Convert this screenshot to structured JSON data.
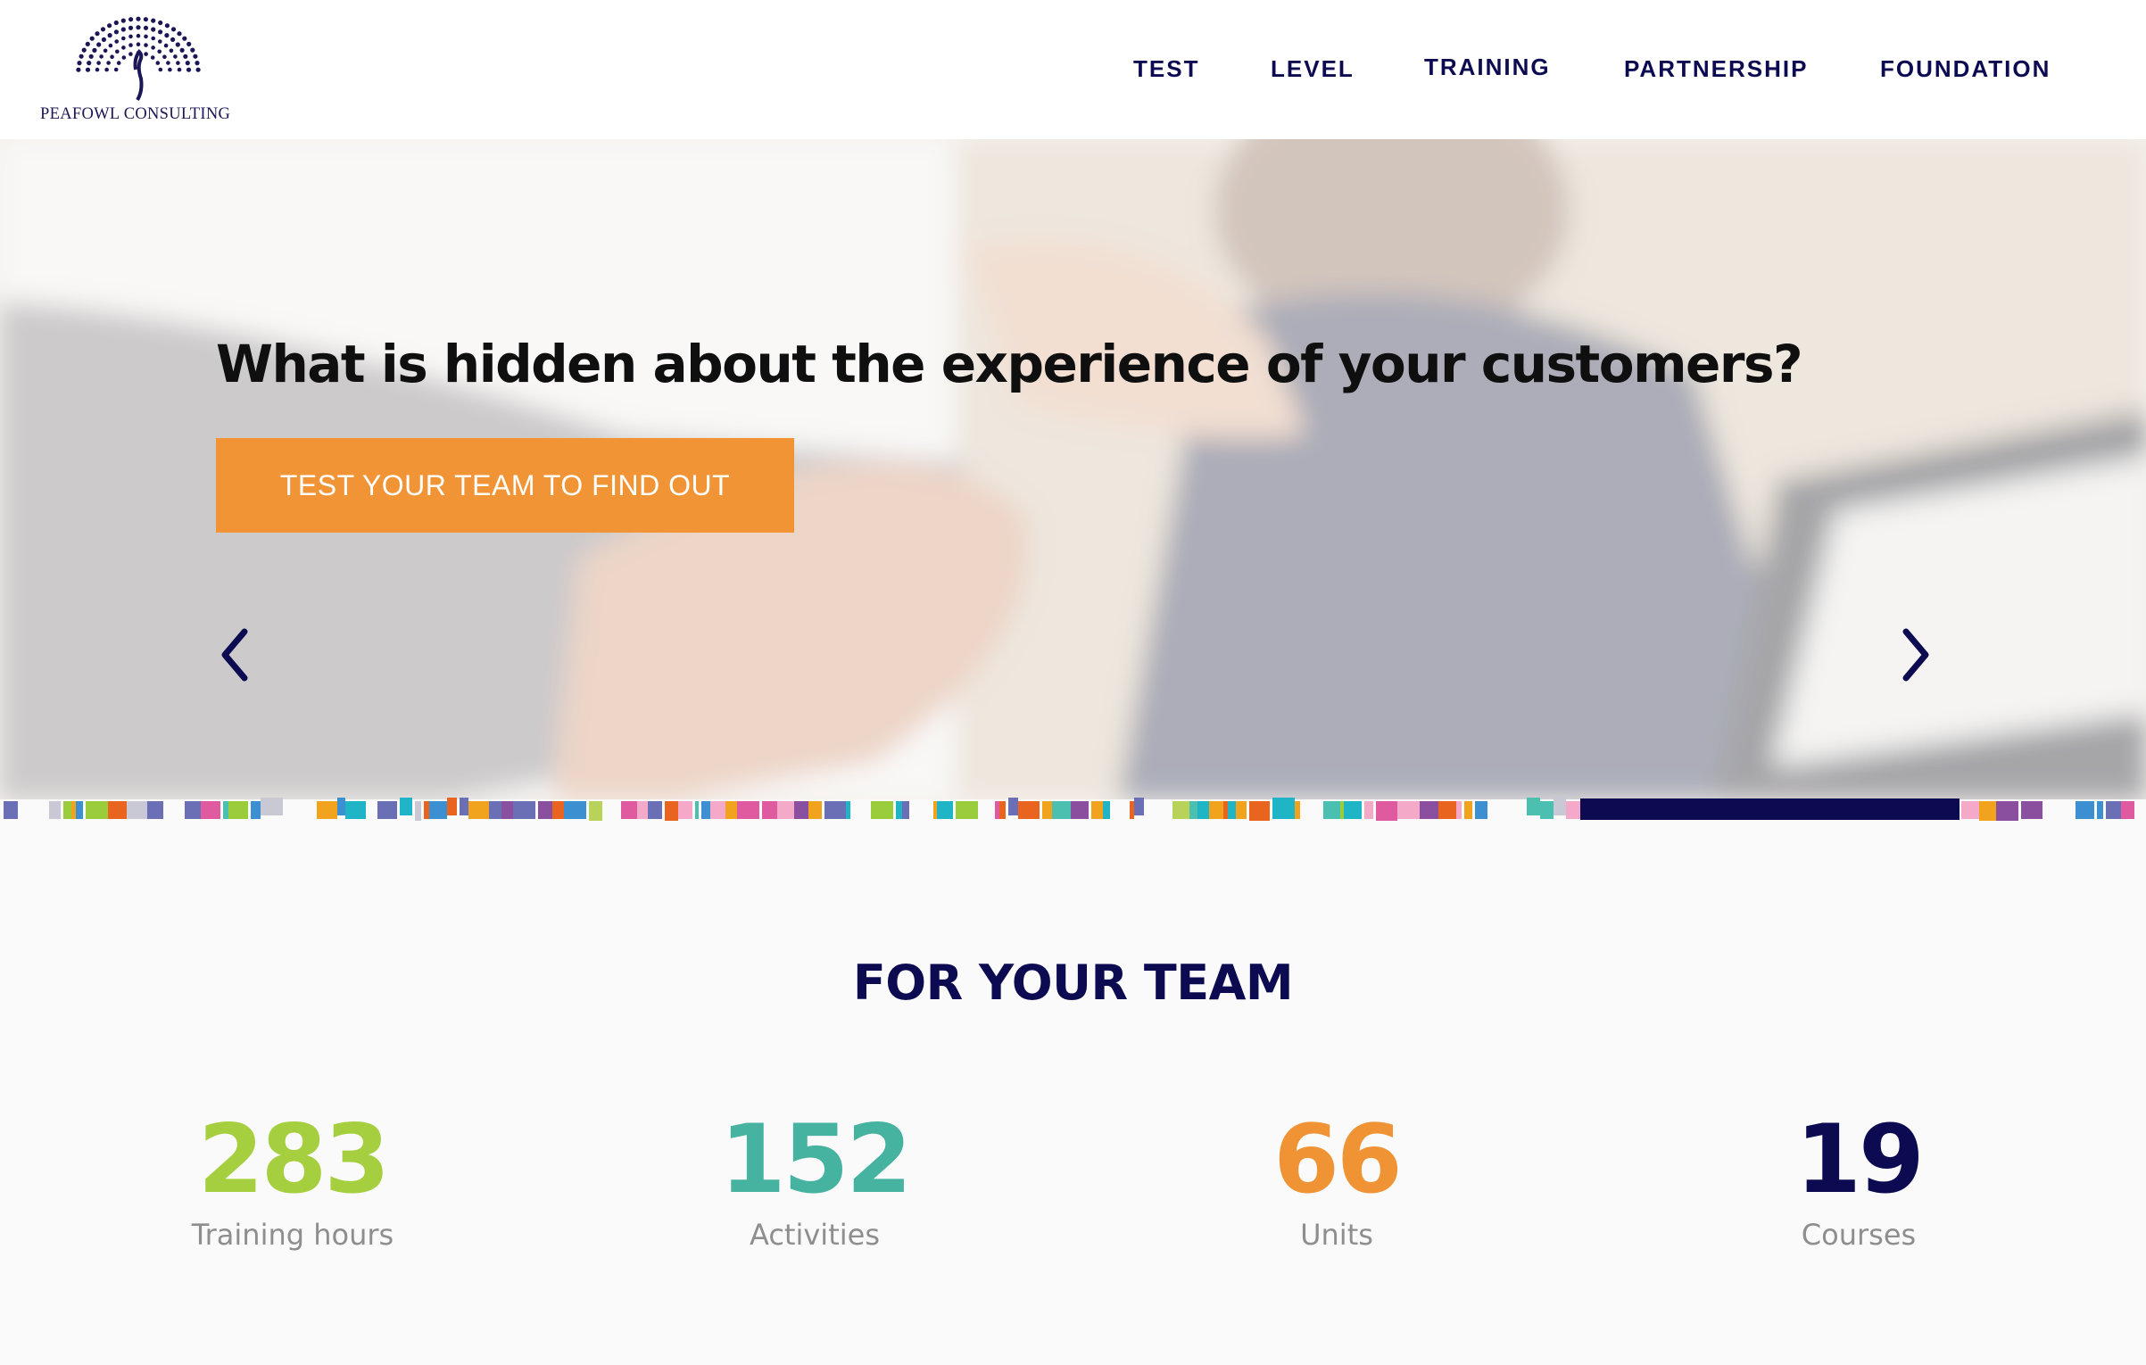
{
  "brand": {
    "logo_text": "PEAFOWL CONSULTING",
    "logo_icon": "peacock-icon",
    "primary_color": "#0c0b52"
  },
  "nav": {
    "items": [
      {
        "label": "TEST"
      },
      {
        "label": "LEVEL"
      },
      {
        "label": "TRAINING"
      },
      {
        "label": "PARTNERSHIP"
      },
      {
        "label": "FOUNDATION"
      }
    ]
  },
  "hero": {
    "title": "What is hidden about the experience of your customers?",
    "cta_label": "TEST YOUR TEAM TO FIND OUT",
    "cta_color": "#f09436",
    "prev_icon": "chevron-left-icon",
    "next_icon": "chevron-right-icon"
  },
  "team": {
    "title": "FOR YOUR TEAM",
    "stats": [
      {
        "value": "283",
        "label": "Training hours",
        "color": "#a6cf3f"
      },
      {
        "value": "152",
        "label": "Activities",
        "color": "#45b3a0"
      },
      {
        "value": "66",
        "label": "Units",
        "color": "#ef9335"
      },
      {
        "value": "19",
        "label": "Courses",
        "color": "#0c0b52"
      }
    ]
  }
}
